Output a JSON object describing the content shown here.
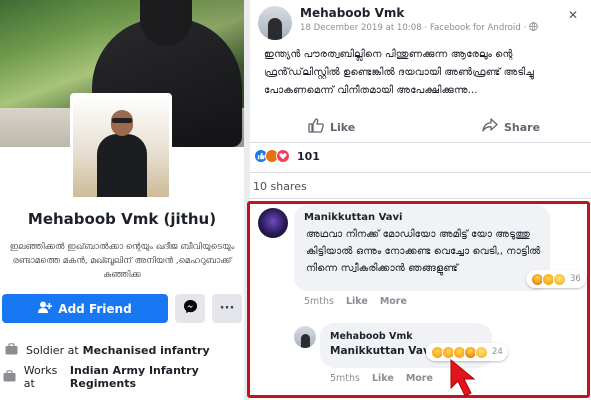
{
  "profile": {
    "name": "Mehaboob Vmk (jithu)",
    "bio": "ഇലഞ്ഞിക്കൽ ഇഖ്‌ബാൽക്കാ ന്റെയും ഖദീജ ബീവിയുടെയും രണ്ടാമത്തെ മകൻ, മഖ്ബൂലിന് അനിയൻ ,മെഹറുബാക്ക് കുഞ്ഞിക്ക",
    "add_friend_label": "Add Friend",
    "more_label": "···",
    "work_line1": {
      "prefix": "Soldier at",
      "place": "Mechanised infantry"
    },
    "work_line2": {
      "prefix": "Works at",
      "place": "Indian Army Infantry Regiments"
    }
  },
  "post": {
    "author": "Mehaboob Vmk",
    "meta": "18 December 2019 at 10:08 · Facebook for Android · ",
    "close_label": "✕",
    "text": "ഇന്ത്യൻ പൗരത്വബില്ലിനെ പിന്തുണക്കുന്ന ആരേലും ന്റെ ഫ്രൻ്ഡ്‌ലിസ്റ്റിൽ ഉണ്ടെങ്കിൽ ദയവായി അൺഫ്രണ്ട് അടിച്ചു പോകണമെന്ന് വിനീതമായി അപേക്ഷിക്കുന്നു...",
    "like_label": "Like",
    "share_label": "Share",
    "reaction_count": "101",
    "shares_label": "10 shares"
  },
  "comments": [
    {
      "author": "Manikkuttan Vavi",
      "text": "അഥവാ നിനക്ക് മോഡിയോ അമിട്ട് യോ അടുത്തു കിട്ടിയാൽ ഒന്നും നോക്കണ്ട വെച്ചോ വെടി,, നാട്ടിൽ നിന്നെ സ്വീകരിക്കാൻ ഞങ്ങളുണ്ട്",
      "reaction_count": "36",
      "time": "5mths",
      "like_label": "Like",
      "more_label": "More"
    },
    {
      "author": "Mehaboob Vmk",
      "text": "Manikkuttan Vavi",
      "reaction_count": "24",
      "time": "5mths",
      "like_label": "Like",
      "more_label": "More"
    }
  ],
  "colors": {
    "accent": "#1877f2",
    "highlight_border": "#c2121d"
  }
}
